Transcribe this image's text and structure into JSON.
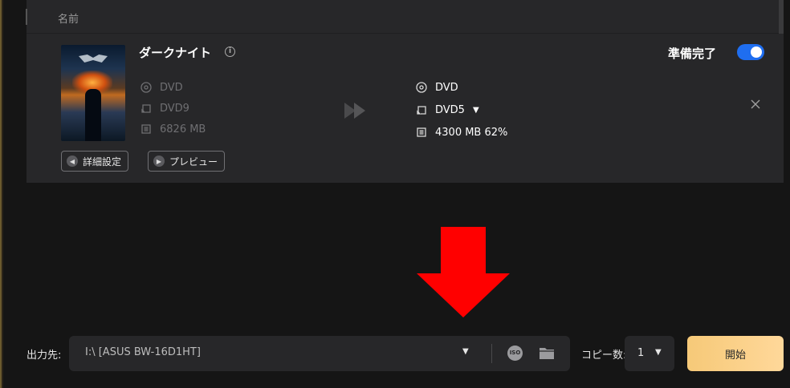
{
  "header": {
    "name_label": "名前"
  },
  "item": {
    "title": "ダークナイト",
    "info_icon": "info-icon",
    "status_label": "準備完了",
    "toggle_on": true,
    "source": {
      "type": "DVD",
      "format": "DVD9",
      "size": "6826 MB"
    },
    "target": {
      "type": "DVD",
      "format": "DVD5",
      "size": "4300 MB 62%"
    },
    "buttons": {
      "settings": "詳細設定",
      "preview": "プレビュー"
    }
  },
  "output": {
    "label": "出力先:",
    "value": "I:\\ [ASUS BW-16D1HT]",
    "iso_label": "ISO"
  },
  "copies": {
    "label": "コピー数:",
    "value": "1"
  },
  "start_button": "開始",
  "colors": {
    "accent": "#1f6ef0",
    "start": "#f6c978",
    "arrow": "#ff0000"
  }
}
